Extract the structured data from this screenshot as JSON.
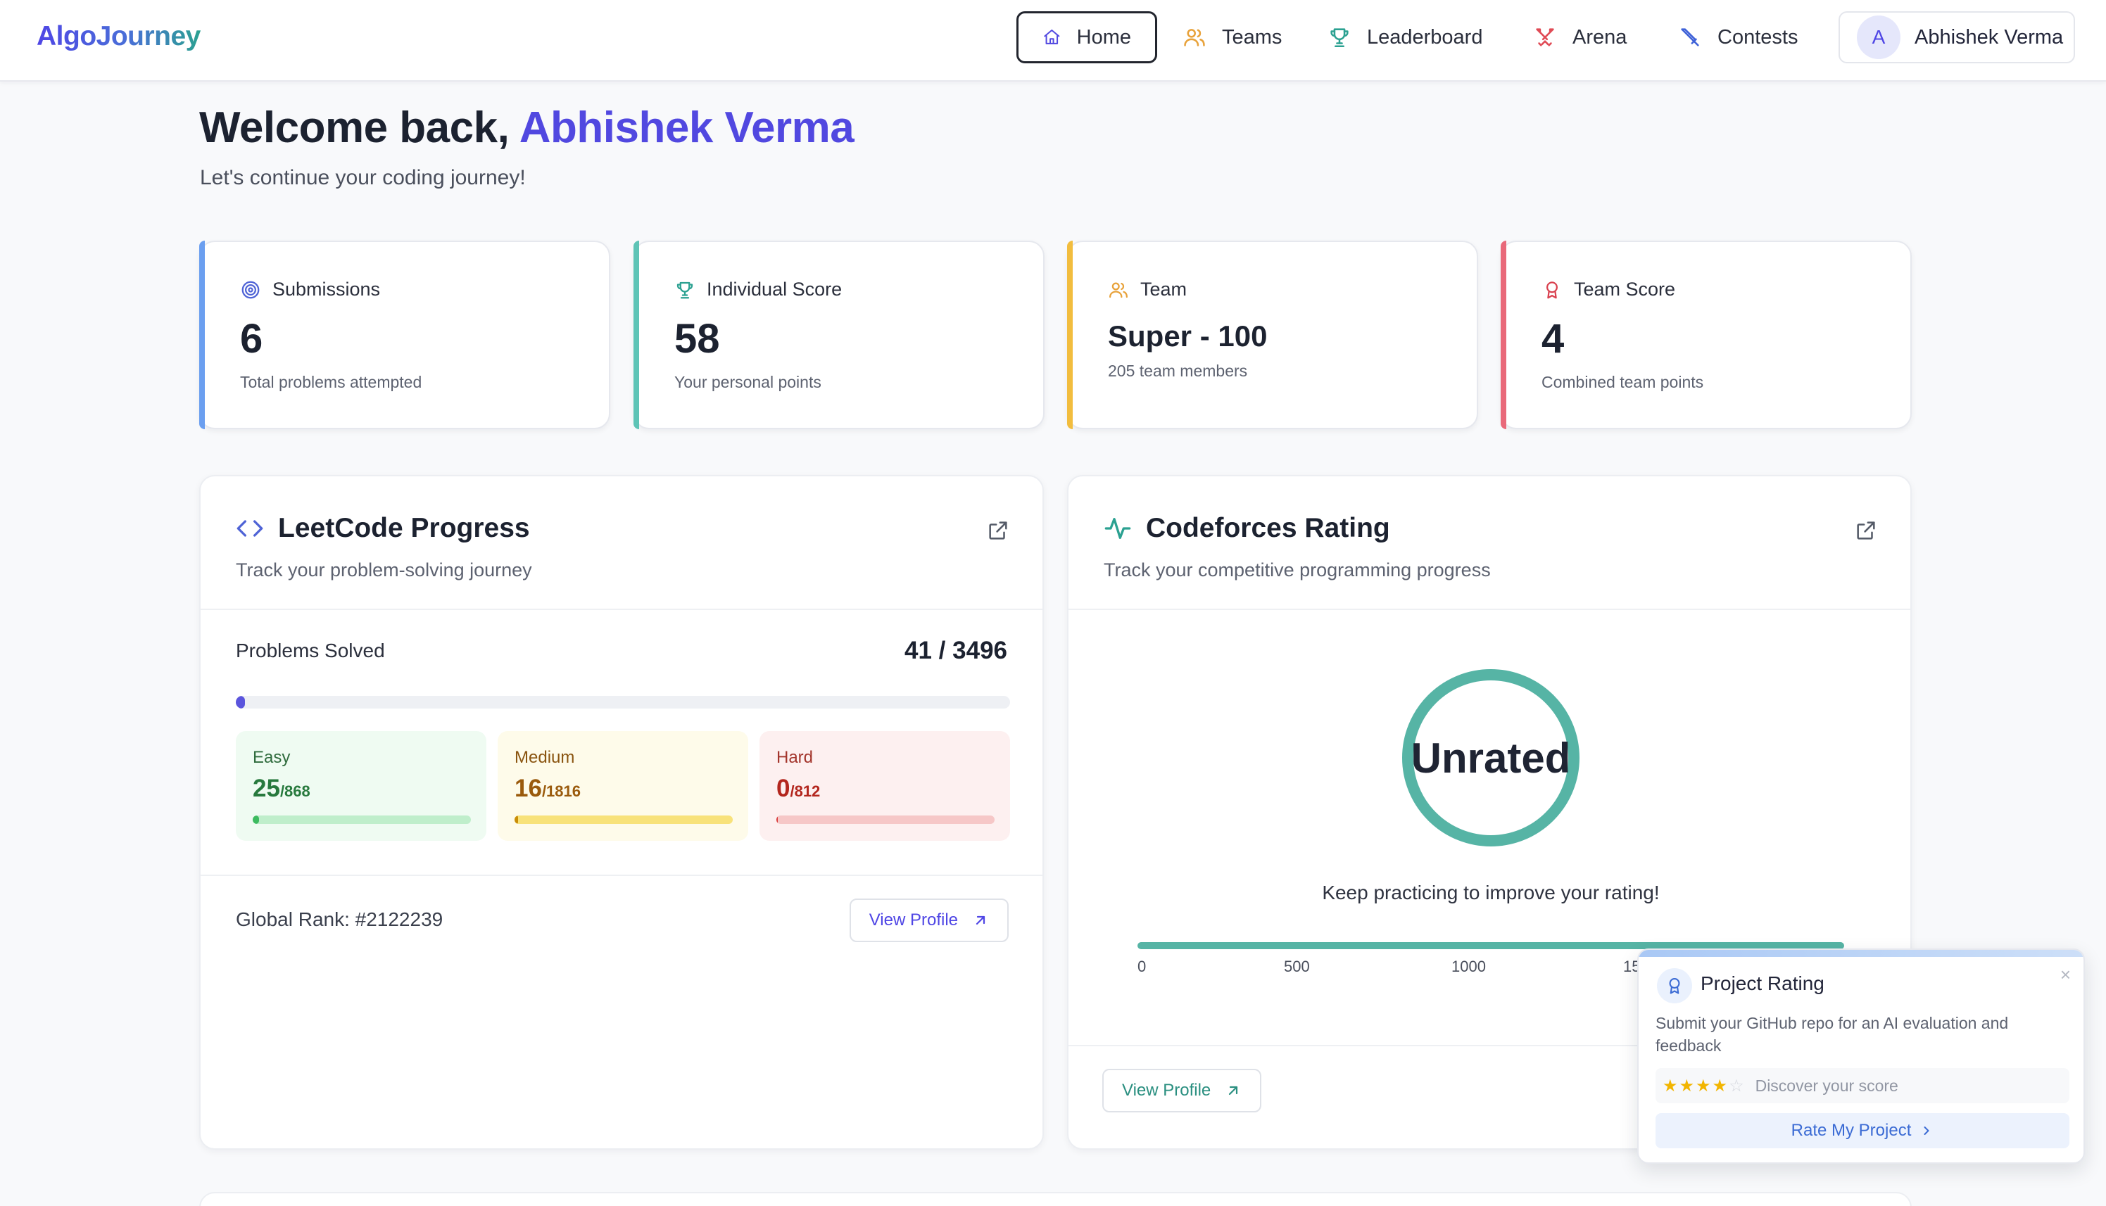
{
  "app": {
    "logo_text": "AlgoJourney"
  },
  "nav": {
    "items": [
      {
        "label": "Home",
        "icon": "home-icon",
        "active": true
      },
      {
        "label": "Teams",
        "icon": "users-icon"
      },
      {
        "label": "Leaderboard",
        "icon": "trophy-icon"
      },
      {
        "label": "Arena",
        "icon": "swords-icon"
      },
      {
        "label": "Contests",
        "icon": "sword-icon"
      }
    ],
    "user": {
      "avatar_initial": "A",
      "name": "Abhishek Verma"
    }
  },
  "welcome": {
    "greeting": "Welcome back, ",
    "name": "Abhishek Verma",
    "subtitle": "Let's continue your coding journey!"
  },
  "stats": [
    {
      "label": "Submissions",
      "value": "6",
      "description": "Total problems attempted",
      "accent": "#6b9ff0",
      "icon": "target-icon"
    },
    {
      "label": "Individual Score",
      "value": "58",
      "description": "Your personal points",
      "accent": "#5ec4b6",
      "icon": "trophy-icon"
    },
    {
      "label": "Team",
      "value": "Super - 100",
      "description": "205 team members",
      "accent": "#f2bd3e",
      "icon": "users-icon"
    },
    {
      "label": "Team Score",
      "value": "4",
      "description": "Combined team points",
      "accent": "#e9697a",
      "icon": "award-icon"
    }
  ],
  "leetcode": {
    "title": "LeetCode Progress",
    "subtitle": "Track your problem-solving journey",
    "solved_label": "Problems Solved",
    "solved": 41,
    "total": 3496,
    "solved_text": "41 / 3496",
    "difficulties": [
      {
        "label": "Easy",
        "solved": "25",
        "total": "/868",
        "fraction": 0.0288
      },
      {
        "label": "Medium",
        "solved": "16",
        "total": "/1816",
        "fraction": 0.0088
      },
      {
        "label": "Hard",
        "solved": "0",
        "total": "/812",
        "fraction": 0
      }
    ],
    "global_rank": "Global Rank: #2122239",
    "view_profile": "View Profile"
  },
  "codeforces": {
    "title": "Codeforces Rating",
    "subtitle": "Track your competitive programming progress",
    "rating_text": "Unrated",
    "message": "Keep practicing to improve your rating!",
    "scale_ticks": [
      "0",
      "500",
      "1000",
      "15"
    ],
    "view_profile": "View Profile"
  },
  "project_rating": {
    "title": "Project Rating",
    "description": "Submit your GitHub repo for an AI evaluation and feedback",
    "stars": 4,
    "max_stars": 5,
    "score_prompt": "Discover your score",
    "button_label": "Rate My Project",
    "close_symbol": "×"
  },
  "colors": {
    "brand": "#5148e0",
    "teal": "#56b4a5"
  }
}
